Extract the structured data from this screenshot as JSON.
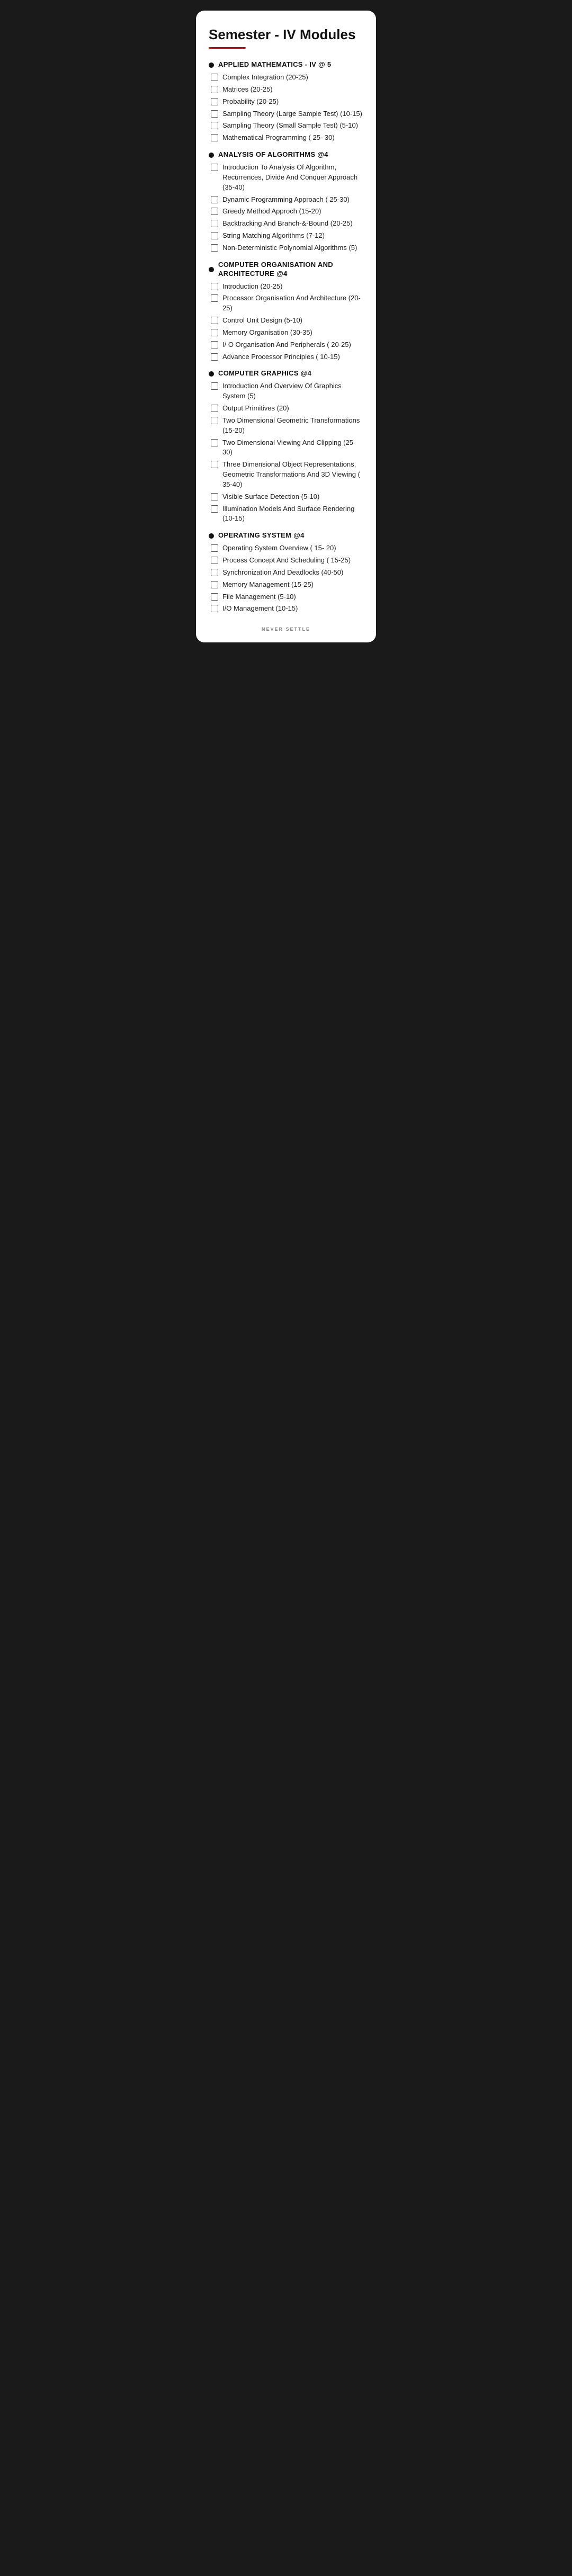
{
  "page": {
    "title": "Semester - IV Modules",
    "footer": "NEVER SETTLE"
  },
  "sections": [
    {
      "id": "applied-math",
      "title": "APPLIED  MATHEMATICS - IV     @ 5",
      "items": [
        "Complex Integration (20-25)",
        "Matrices (20-25)",
        "Probability (20-25)",
        "Sampling Theory (Large Sample Test) (10-15)",
        "Sampling Theory (Small Sample Test) (5-10)",
        "Mathematical  Programming  ( 25- 30)"
      ]
    },
    {
      "id": "analysis-algorithms",
      "title": "ANALYSIS OF ALGORITHMS    @4",
      "items": [
        "Introduction To Analysis Of Algorithm, Recurrences, Divide And Conquer Approach (35-40)",
        "Dynamic  Programming  Approach  ( 25-30)",
        "Greedy Method Approch (15-20)",
        "Backtracking And Branch-&-Bound (20-25)",
        "String Matching Algorithms (7-12)",
        "Non-Deterministic Polynomial Algorithms (5)"
      ]
    },
    {
      "id": "computer-org",
      "title": "COMPUTER ORGANISATION AND ARCHITECTURE    @4",
      "items": [
        "Introduction (20-25)",
        "Processor Organisation And Architecture (20-25)",
        "Control Unit Design (5-10)",
        "Memory Organisation (30-35)",
        "I/ O  Organisation  And  Peripherals  ( 20-25)",
        "Advance Processor Principles ( 10-15)"
      ]
    },
    {
      "id": "computer-graphics",
      "title": "COMPUTER GRAPHICS    @4",
      "items": [
        "Introduction And Overview Of Graphics System (5)",
        "Output Primitives (20)",
        "Two Dimensional Geometric Transformations (15-20)",
        "Two Dimensional Viewing And Clipping (25-30)",
        "Three Dimensional Object Representations, Geometric Transformations And 3D Viewing ( 35-40)",
        "Visible Surface Detection (5-10)",
        "Illumination Models And Surface Rendering (10-15)"
      ]
    },
    {
      "id": "operating-system",
      "title": "OPERATING SYSTEM    @4",
      "items": [
        " Operating  System  Overview  ( 15- 20)",
        "Process Concept And Scheduling ( 15-25)",
        "Synchronization And Deadlocks (40-50)",
        "Memory Management (15-25)",
        "File Management (5-10)",
        "I/O Management (10-15)"
      ]
    }
  ]
}
